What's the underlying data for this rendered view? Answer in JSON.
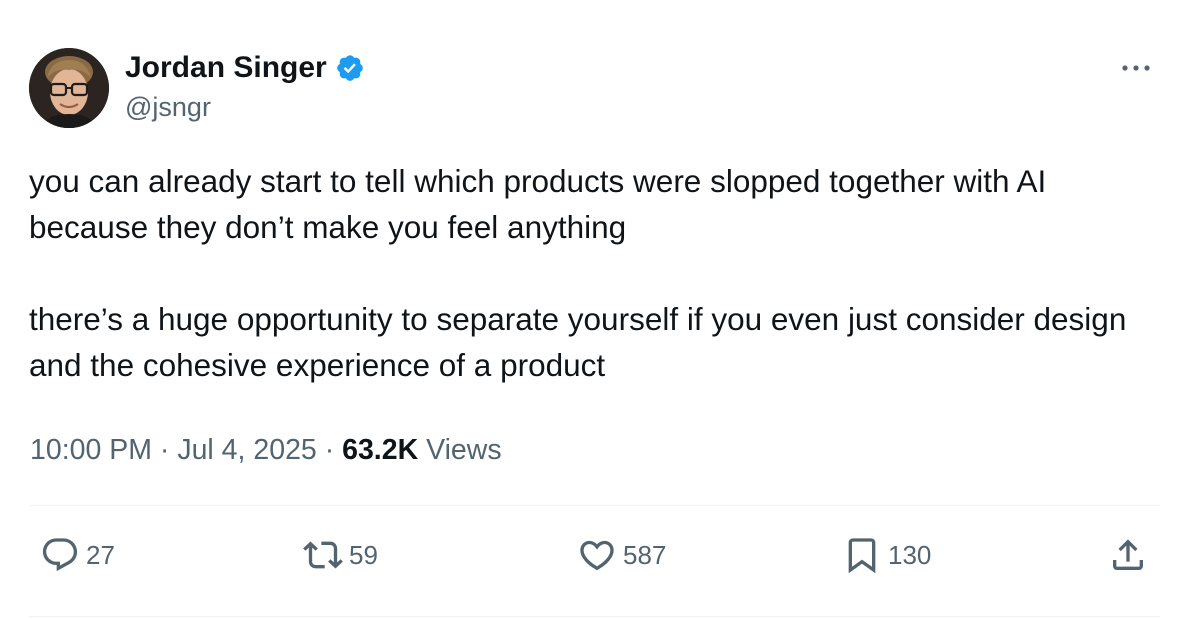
{
  "author": {
    "display_name": "Jordan Singer",
    "handle": "@jsngr",
    "verified": true
  },
  "tweet": {
    "paragraphs": [
      "you can already start to tell which products were slopped together with AI because they don’t make you feel anything",
      "there’s a huge opportunity to separate yourself if you even just consider design and the cohesive experience of a product"
    ],
    "time": "10:00 PM",
    "separator": " · ",
    "date": "Jul 4, 2025",
    "views_count": "63.2K",
    "views_label": "Views"
  },
  "actions": {
    "replies": "27",
    "reposts": "59",
    "likes": "587",
    "bookmarks": "130"
  },
  "icons": {
    "verified": "verified-badge-icon",
    "more": "more-options-icon",
    "reply": "reply-icon",
    "repost": "repost-icon",
    "like": "heart-icon",
    "bookmark": "bookmark-icon",
    "share": "share-icon"
  },
  "colors": {
    "verified": "#1d9bf0",
    "text": "#0f1419",
    "secondary": "#536471",
    "divider": "#eff3f4"
  }
}
